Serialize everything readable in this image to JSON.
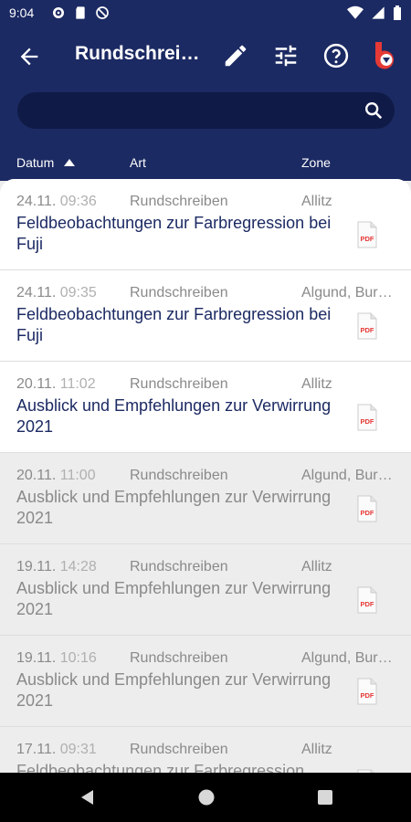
{
  "status": {
    "time": "9:04"
  },
  "appbar": {
    "title": "Rundschreiben"
  },
  "search": {
    "placeholder": "",
    "value": ""
  },
  "columns": {
    "date": "Datum",
    "type": "Art",
    "zone": "Zone"
  },
  "rows": [
    {
      "day": "24.11.",
      "time": "09:36",
      "type": "Rundschreiben",
      "zone": "Allitz",
      "title": "Feldbeobachtungen zur Farbregression bei Fuji",
      "unread": true
    },
    {
      "day": "24.11.",
      "time": "09:35",
      "type": "Rundschreiben",
      "zone": "Algund, Burgstall",
      "title": "Feldbeobachtungen zur Farbregression bei Fuji",
      "unread": true
    },
    {
      "day": "20.11.",
      "time": "11:02",
      "type": "Rundschreiben",
      "zone": "Allitz",
      "title": "Ausblick und Empfehlungen zur Verwirrung 2021",
      "unread": true
    },
    {
      "day": "20.11.",
      "time": "11:00",
      "type": "Rundschreiben",
      "zone": "Algund, Burgstall",
      "title": "Ausblick und Empfehlungen zur Verwirrung 2021",
      "unread": false
    },
    {
      "day": "19.11.",
      "time": "14:28",
      "type": "Rundschreiben",
      "zone": "Allitz",
      "title": "Ausblick und Empfehlungen zur Verwirrung 2021",
      "unread": false
    },
    {
      "day": "19.11.",
      "time": "10:16",
      "type": "Rundschreiben",
      "zone": "Algund, Burgstall",
      "title": "Ausblick und Empfehlungen zur Verwirrung 2021",
      "unread": false
    },
    {
      "day": "17.11.",
      "time": "09:31",
      "type": "Rundschreiben",
      "zone": "Allitz",
      "title": "Feldbeobachtungen zur Farbregression",
      "unread": false
    }
  ],
  "icons": {
    "status_left": [
      "gear-icon",
      "sd-card-icon",
      "no-data-icon"
    ],
    "status_right": [
      "wifi-icon",
      "signal-icon",
      "battery-icon"
    ],
    "appbar": [
      "back-arrow-icon",
      "edit-icon",
      "tune-icon",
      "help-icon",
      "app-logo-icon"
    ],
    "search": "search-icon",
    "row": "pdf-icon"
  },
  "colors": {
    "primary": "#1c2a63",
    "search_field": "#0f1a47",
    "unread_bg": "#ffffff",
    "read_bg": "#ededed",
    "pdf_red": "#e53935"
  }
}
